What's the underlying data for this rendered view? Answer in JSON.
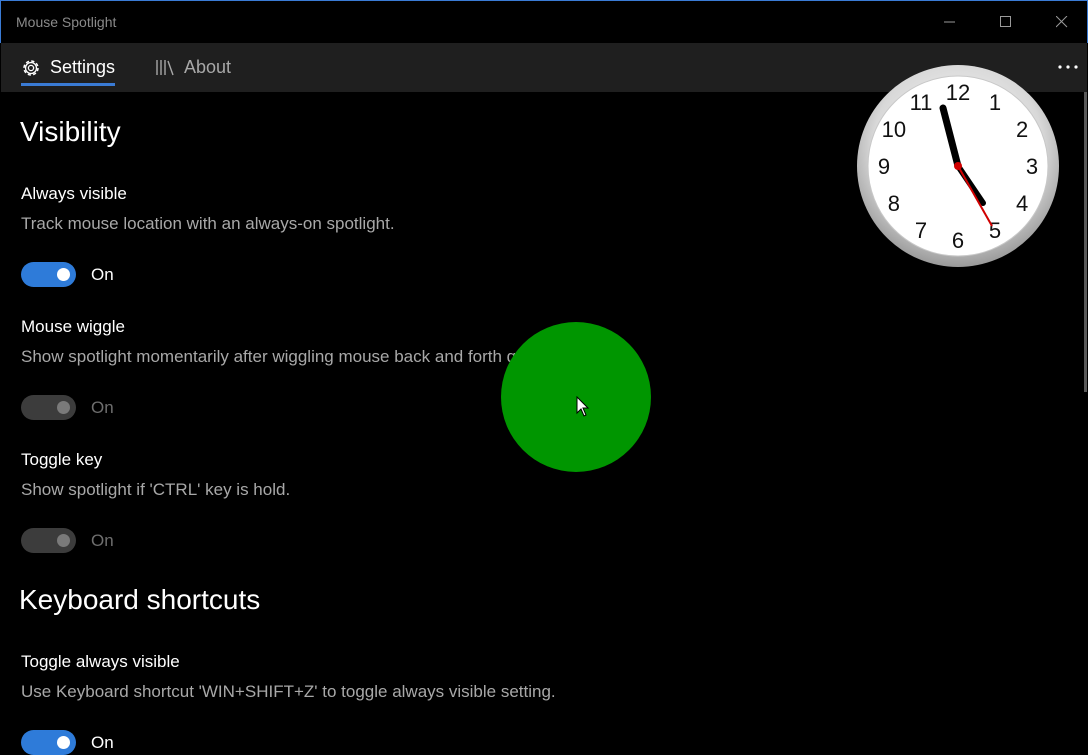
{
  "window": {
    "title": "Mouse Spotlight"
  },
  "tabs": [
    {
      "label": "Settings",
      "icon": "gear-icon",
      "selected": true
    },
    {
      "label": "About",
      "icon": "library-icon",
      "selected": false
    }
  ],
  "sections": {
    "visibility": {
      "heading": "Visibility",
      "always_visible": {
        "title": "Always visible",
        "desc": "Track mouse location with an always-on spotlight.",
        "state": "On",
        "enabled": true
      },
      "mouse_wiggle": {
        "title": "Mouse wiggle",
        "desc": "Show spotlight momentarily after wiggling mouse back and forth quickly.",
        "state": "On",
        "enabled": false
      },
      "toggle_key": {
        "title": "Toggle key",
        "desc": "Show spotlight if 'CTRL' key is hold.",
        "state": "On",
        "enabled": false
      }
    },
    "keyboard": {
      "heading": "Keyboard shortcuts",
      "toggle_always_visible": {
        "title": "Toggle always visible",
        "desc": "Use Keyboard shortcut 'WIN+SHIFT+Z' to toggle always visible setting.",
        "state": "On",
        "enabled": true
      }
    }
  },
  "clock": {
    "numbers": [
      "12",
      "1",
      "2",
      "3",
      "4",
      "5",
      "6",
      "7",
      "8",
      "9",
      "10",
      "11"
    ],
    "hour_hand": "11",
    "minute_hand": "5"
  },
  "colors": {
    "accent": "#2e7bd9",
    "spotlight": "#009600",
    "background": "#000000",
    "tabbar": "#1f1f1f"
  }
}
